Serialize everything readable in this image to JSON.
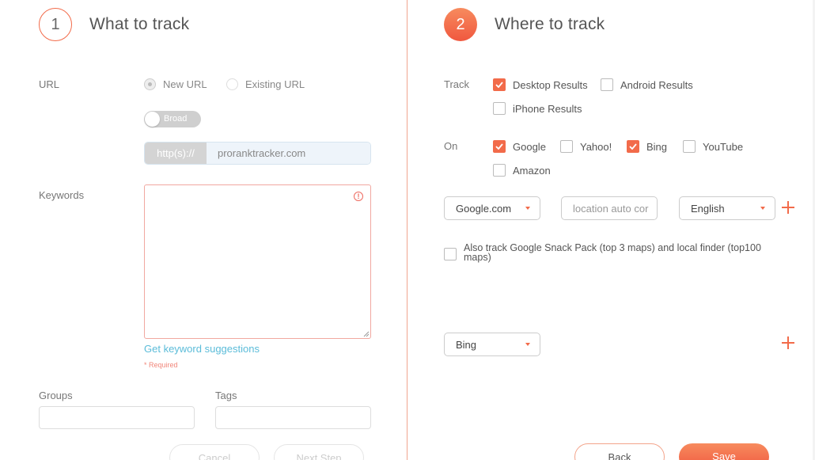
{
  "left": {
    "step_number": "1",
    "title": "What to track",
    "url_label": "URL",
    "url_options": [
      "New URL",
      "Existing URL"
    ],
    "url_selected": "New URL",
    "match_toggle": "Broad",
    "url_prefix": "http(s)://",
    "url_value": "proranktracker.com",
    "keywords_label": "Keywords",
    "keyword_suggestions_link": "Get keyword suggestions",
    "required_note": "* Required",
    "groups_label": "Groups",
    "tags_label": "Tags",
    "cancel_label": "Cancel",
    "next_label": "Next Step"
  },
  "right": {
    "step_number": "2",
    "title": "Where to track",
    "track_label": "Track",
    "track_options": [
      {
        "label": "Desktop Results",
        "checked": true
      },
      {
        "label": "Android Results",
        "checked": false
      },
      {
        "label": "iPhone Results",
        "checked": false
      }
    ],
    "on_label": "On",
    "engines": [
      {
        "label": "Google",
        "checked": true
      },
      {
        "label": "Yahoo!",
        "checked": false
      },
      {
        "label": "Bing",
        "checked": true
      },
      {
        "label": "YouTube",
        "checked": false
      },
      {
        "label": "Amazon",
        "checked": false
      }
    ],
    "google_domain": "Google.com",
    "location_placeholder": "location auto cor",
    "language": "English",
    "snack_pack_label": "Also track Google Snack Pack (top 3 maps) and local finder (top100 maps)",
    "bing_domain": "Bing",
    "back_label": "Back",
    "save_label": "Save"
  },
  "colors": {
    "accent": "#f26b4a",
    "link": "#5bbcd9",
    "required": "#f1867a"
  }
}
